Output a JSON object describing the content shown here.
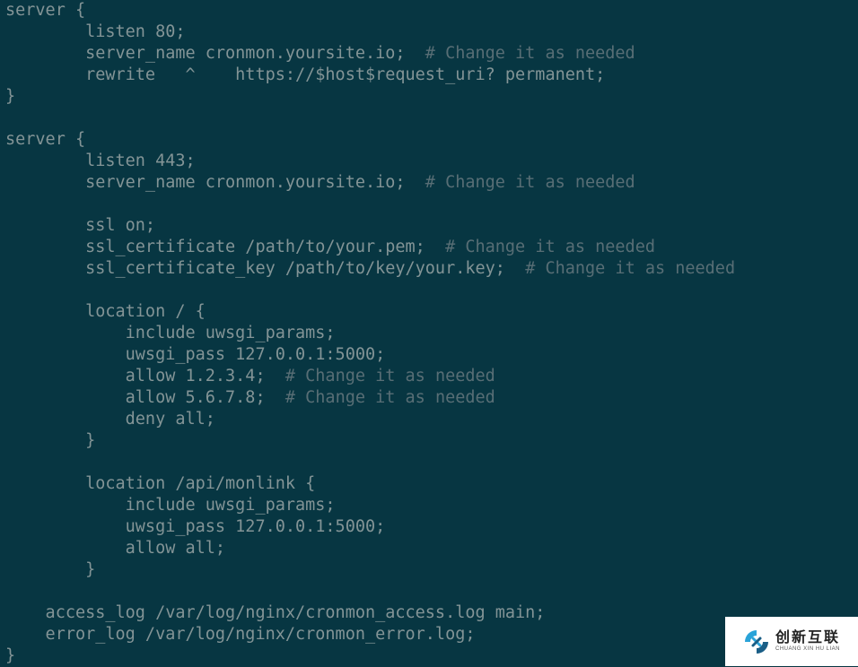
{
  "code": {
    "lines": [
      {
        "segments": [
          {
            "t": "server {",
            "c": "txt"
          }
        ]
      },
      {
        "segments": [
          {
            "t": "        listen 80;",
            "c": "txt"
          }
        ]
      },
      {
        "segments": [
          {
            "t": "        server_name cronmon.yoursite.io;  ",
            "c": "txt"
          },
          {
            "t": "# Change it as needed",
            "c": "cmt"
          }
        ]
      },
      {
        "segments": [
          {
            "t": "        rewrite   ^    https://$host$request_uri? permanent;",
            "c": "txt"
          }
        ]
      },
      {
        "segments": [
          {
            "t": "}",
            "c": "txt"
          }
        ]
      },
      {
        "segments": [
          {
            "t": "",
            "c": "txt"
          }
        ]
      },
      {
        "segments": [
          {
            "t": "server {",
            "c": "txt"
          }
        ]
      },
      {
        "segments": [
          {
            "t": "        listen 443;",
            "c": "txt"
          }
        ]
      },
      {
        "segments": [
          {
            "t": "        server_name cronmon.yoursite.io;  ",
            "c": "txt"
          },
          {
            "t": "# Change it as needed",
            "c": "cmt"
          }
        ]
      },
      {
        "segments": [
          {
            "t": "",
            "c": "txt"
          }
        ]
      },
      {
        "segments": [
          {
            "t": "        ssl on;",
            "c": "txt"
          }
        ]
      },
      {
        "segments": [
          {
            "t": "        ssl_certificate /path/to/your.pem;  ",
            "c": "txt"
          },
          {
            "t": "# Change it as needed",
            "c": "cmt"
          }
        ]
      },
      {
        "segments": [
          {
            "t": "        ssl_certificate_key /path/to/key/your.key;  ",
            "c": "txt"
          },
          {
            "t": "# Change it as needed",
            "c": "cmt"
          }
        ]
      },
      {
        "segments": [
          {
            "t": "",
            "c": "txt"
          }
        ]
      },
      {
        "segments": [
          {
            "t": "        location / {",
            "c": "txt"
          }
        ]
      },
      {
        "segments": [
          {
            "t": "            include uwsgi_params;",
            "c": "txt"
          }
        ]
      },
      {
        "segments": [
          {
            "t": "            uwsgi_pass 127.0.0.1:5000;",
            "c": "txt"
          }
        ]
      },
      {
        "segments": [
          {
            "t": "            allow 1.2.3.4;  ",
            "c": "txt"
          },
          {
            "t": "# Change it as needed",
            "c": "cmt"
          }
        ]
      },
      {
        "segments": [
          {
            "t": "            allow 5.6.7.8;  ",
            "c": "txt"
          },
          {
            "t": "# Change it as needed",
            "c": "cmt"
          }
        ]
      },
      {
        "segments": [
          {
            "t": "            deny all;",
            "c": "txt"
          }
        ]
      },
      {
        "segments": [
          {
            "t": "        }",
            "c": "txt"
          }
        ]
      },
      {
        "segments": [
          {
            "t": "",
            "c": "txt"
          }
        ]
      },
      {
        "segments": [
          {
            "t": "        location /api/monlink {",
            "c": "txt"
          }
        ]
      },
      {
        "segments": [
          {
            "t": "            include uwsgi_params;",
            "c": "txt"
          }
        ]
      },
      {
        "segments": [
          {
            "t": "            uwsgi_pass 127.0.0.1:5000;",
            "c": "txt"
          }
        ]
      },
      {
        "segments": [
          {
            "t": "            allow all;",
            "c": "txt"
          }
        ]
      },
      {
        "segments": [
          {
            "t": "        }",
            "c": "txt"
          }
        ]
      },
      {
        "segments": [
          {
            "t": "",
            "c": "txt"
          }
        ]
      },
      {
        "segments": [
          {
            "t": "    access_log /var/log/nginx/cronmon_access.log main;",
            "c": "txt"
          }
        ]
      },
      {
        "segments": [
          {
            "t": "    error_log /var/log/nginx/cronmon_error.log;",
            "c": "txt"
          }
        ]
      },
      {
        "segments": [
          {
            "t": "}",
            "c": "txt"
          }
        ]
      }
    ]
  },
  "logo": {
    "cn": "创新互联",
    "en": "CHUANG XIN HU LIAN"
  }
}
